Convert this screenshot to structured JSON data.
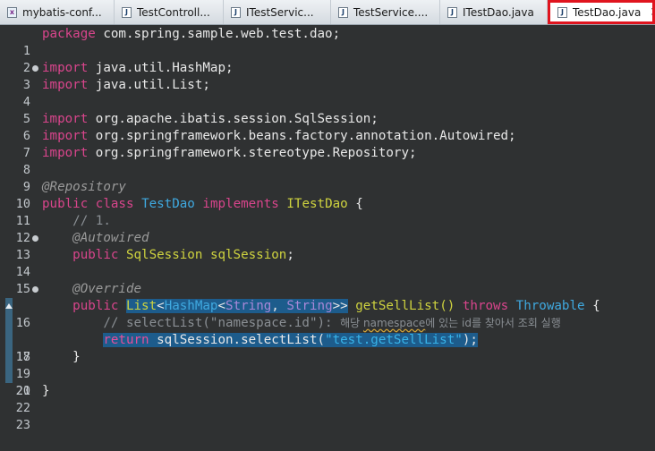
{
  "tabs": [
    {
      "label": "mybatis-conf...",
      "icon": "xml-file-icon",
      "active": false
    },
    {
      "label": "TestControll...",
      "icon": "java-file-icon",
      "active": false
    },
    {
      "label": "ITestServic...",
      "icon": "java-file-icon",
      "active": false
    },
    {
      "label": "TestService....",
      "icon": "java-file-icon",
      "active": false
    },
    {
      "label": "ITestDao.java",
      "icon": "java-file-icon",
      "active": false
    },
    {
      "label": "TestDao.java",
      "icon": "java-file-icon",
      "active": true
    }
  ],
  "editor": {
    "lines": [
      {
        "n": "1",
        "text": "package com.spring.sample.web.test.dao;"
      },
      {
        "n": "2",
        "text": ""
      },
      {
        "n": "3",
        "text": "import java.util.HashMap;"
      },
      {
        "n": "4",
        "text": "import java.util.List;"
      },
      {
        "n": "5",
        "text": ""
      },
      {
        "n": "6",
        "text": "import org.apache.ibatis.session.SqlSession;"
      },
      {
        "n": "7",
        "text": "import org.springframework.beans.factory.annotation.Autowired;"
      },
      {
        "n": "8",
        "text": "import org.springframework.stereotype.Repository;"
      },
      {
        "n": "9",
        "text": ""
      },
      {
        "n": "10",
        "text": "@Repository"
      },
      {
        "n": "11",
        "text": "public class TestDao implements ITestDao {"
      },
      {
        "n": "12",
        "text": "    // 1."
      },
      {
        "n": "13",
        "text": "    @Autowired"
      },
      {
        "n": "14",
        "text": "    public SqlSession sqlSession;"
      },
      {
        "n": "15",
        "text": ""
      },
      {
        "n": "16",
        "text": "    @Override"
      },
      {
        "n": "17",
        "text": "    public List<HashMap<String, String>> getSellList() throws Throwable {"
      },
      {
        "n": "18",
        "text": "        // selectList(\"namespace.id\"): 해당 namespace에 있는 id를 찾아서 조회 실행"
      },
      {
        "n": "19",
        "text": "        return sqlSession.selectList(\"test.getSellList\");"
      },
      {
        "n": "20",
        "text": "    }"
      },
      {
        "n": "21",
        "text": ""
      },
      {
        "n": "22",
        "text": "}"
      },
      {
        "n": "23",
        "text": ""
      }
    ]
  },
  "tokens": {
    "kw_package": "package",
    "pkg_name": "com.spring.sample.web.test.dao;",
    "kw_import": "import",
    "imp_hashmap": "java.util.HashMap;",
    "imp_list": "java.util.List;",
    "imp_sqlsession": "org.apache.ibatis.session.SqlSession;",
    "imp_autowired": "org.springframework.beans.factory.annotation.Autowired;",
    "imp_repository": "org.springframework.stereotype.Repository;",
    "ann_repository": "@Repository",
    "kw_public": "public",
    "kw_class": "class",
    "cls_testdao": "TestDao",
    "kw_implements": "implements",
    "cls_itestdao": "ITestDao",
    "brace_open": "{",
    "cm_1": "// 1.",
    "ann_autowired": "@Autowired",
    "typ_sqlsession": "SqlSession",
    "var_sqlsession": "sqlSession",
    "semi": ";",
    "ann_override": "@Override",
    "typ_list": "List",
    "lt": "<",
    "typ_hashmap": "HashMap",
    "typ_string": "String",
    "comma": ",",
    "gt2": ">>",
    "mth_getselllist": "getSellList()",
    "kw_throws": "throws",
    "typ_throwable": "Throwable",
    "cm_18a": "// selectList(\"namespace.id\"): ",
    "cm_18b": "해당 ",
    "cm_18c": "namespace",
    "cm_18d": "에 있는 id를 찾아서 조회 실행",
    "kw_return": "return",
    "call_select": "sqlSession.selectList(",
    "str_test": "\"test.getSellList\"",
    "call_end": ");",
    "brace_close": "}"
  },
  "colors": {
    "editor_bg": "#2f3132",
    "keyword": "#d9458c",
    "string": "#38b3e8",
    "type": "#cfd33f",
    "selection": "#1d5c8c",
    "active_tab_border": "#e0141e"
  }
}
